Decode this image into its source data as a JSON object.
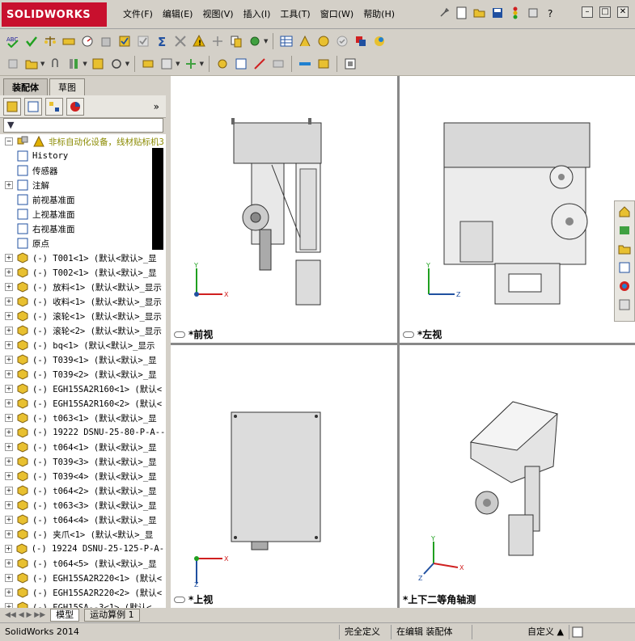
{
  "app": {
    "title": "SOLIDWORKS"
  },
  "menu": [
    "文件(F)",
    "编辑(E)",
    "视图(V)",
    "插入(I)",
    "工具(T)",
    "窗口(W)",
    "帮助(H)"
  ],
  "left_tabs": {
    "tab1": "装配体",
    "tab2": "草图"
  },
  "filter_label": "▼",
  "tree": {
    "root": "非标自动化设备，线材贴标机3",
    "fixed": [
      {
        "label": "History",
        "icon": "history-icon",
        "exp": false
      },
      {
        "label": "传感器",
        "icon": "sensor-icon",
        "exp": false
      },
      {
        "label": "注解",
        "icon": "annotation-icon",
        "exp": true
      },
      {
        "label": "前视基准面",
        "icon": "plane-icon",
        "exp": false
      },
      {
        "label": "上视基准面",
        "icon": "plane-icon",
        "exp": false
      },
      {
        "label": "右视基准面",
        "icon": "plane-icon",
        "exp": false
      },
      {
        "label": "原点",
        "icon": "origin-icon",
        "exp": false
      }
    ],
    "components": [
      "(-) T001<1> (默认<默认>_显",
      "(-) T002<1> (默认<默认>_显",
      "(-) 放料<1> (默认<默认>_显示",
      "(-) 收料<1> (默认<默认>_显示",
      "(-) 滚轮<1> (默认<默认>_显示",
      "(-) 滚轮<2> (默认<默认>_显示",
      "(-) bq<1> (默认<默认>_显示",
      "(-) T039<1> (默认<默认>_显",
      "(-) T039<2> (默认<默认>_显",
      "(-) EGH15SA2R160<1> (默认<",
      "(-) EGH15SA2R160<2> (默认<",
      "(-) t063<1> (默认<默认>_显",
      "(-) 19222 DSNU-25-80-P-A--",
      "(-) t064<1> (默认<默认>_显",
      "(-) T039<3> (默认<默认>_显",
      "(-) T039<4> (默认<默认>_显",
      "(-) t064<2> (默认<默认>_显",
      "(-) t063<3> (默认<默认>_显",
      "(-) t064<4> (默认<默认>_显",
      "(-) 夹爪<1> (默认<默认>_显",
      "(-) 19224 DSNU-25-125-P-A--",
      "(-) t064<5> (默认<默认>_显",
      "(-) EGH15SA2R220<1> (默认<",
      "(-) EGH15SA2R220<2> (默认<",
      "(-) EGH15SA--3<1> (默认<"
    ]
  },
  "viewports": {
    "front": "*前视",
    "left": "*左视",
    "top": "*上视",
    "iso": "*上下二等角轴测"
  },
  "bottom_tabs": {
    "model": "模型",
    "motion": "运动算例 1"
  },
  "status": {
    "app": "SolidWorks 2014",
    "defined": "完全定义",
    "editing": "在编辑 装配体",
    "custom": "自定义"
  },
  "colors": {
    "accent": "#c8102e",
    "warning": "#e0b000"
  }
}
